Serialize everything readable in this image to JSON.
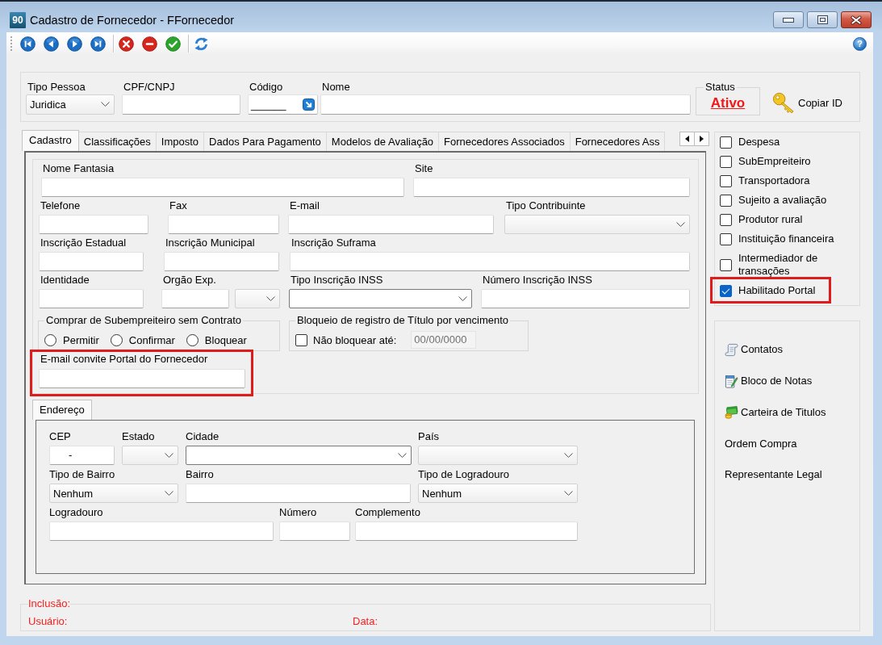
{
  "window": {
    "title": "Cadastro de Fornecedor - FFornecedor",
    "logo": "90",
    "help": "?"
  },
  "header": {
    "fields": [
      {
        "label": "Tipo Pessoa",
        "kind": "select",
        "value": "Juridica"
      },
      {
        "label": "CPF/CNPJ",
        "kind": "text"
      },
      {
        "label": "Código",
        "kind": "lookup",
        "value": "______"
      },
      {
        "label": "Nome",
        "kind": "text"
      }
    ],
    "status": {
      "label": "Status",
      "value": "Ativo"
    },
    "copy_id": "Copiar ID"
  },
  "tabs": [
    {
      "label": "Cadastro",
      "selected": true
    },
    {
      "label": "Classificações",
      "selected": false
    },
    {
      "label": "Imposto",
      "selected": false
    },
    {
      "label": "Dados Para Pagamento",
      "selected": false
    },
    {
      "label": "Modelos de Avaliação",
      "selected": false
    },
    {
      "label": "Fornecedores Associados",
      "selected": false
    },
    {
      "label": "Fornecedores Ass",
      "selected": false
    }
  ],
  "cadastro": {
    "lines": [
      {
        "fields": [
          {
            "label": "Nome Fantasia",
            "kind": "text"
          },
          {
            "label": "Site",
            "kind": "text"
          }
        ]
      },
      {
        "fields": [
          {
            "label": "Telefone",
            "kind": "text"
          },
          {
            "label": "Fax",
            "kind": "text"
          },
          {
            "label": "E-mail",
            "kind": "text"
          },
          {
            "label": "Tipo Contribuinte",
            "kind": "select"
          }
        ]
      },
      {
        "fields": [
          {
            "label": "Inscrição Estadual",
            "kind": "text"
          },
          {
            "label": "Inscrição Municipal",
            "kind": "text"
          },
          {
            "label": "Inscrição Suframa",
            "kind": "text"
          }
        ]
      },
      {
        "fields": [
          {
            "label": "Identidade",
            "kind": "text"
          },
          {
            "label": "Orgão Exp.",
            "kind": "text"
          },
          {
            "kind": "select"
          },
          {
            "label": "Tipo Inscrição INSS",
            "kind": "combo"
          },
          {
            "label": "Número Inscrição INSS",
            "kind": "text"
          }
        ]
      }
    ],
    "purchase_group": {
      "title": "Comprar de Subempreiteiro sem Contrato",
      "options": [
        {
          "label": "Permitir",
          "selected": false
        },
        {
          "label": "Confirmar",
          "selected": false
        },
        {
          "label": "Bloquear",
          "selected": false
        }
      ]
    },
    "block_group": {
      "title": "Bloqueio de registro de Título por vencimento",
      "checkbox": {
        "label": "Não bloquear até:",
        "checked": false
      },
      "date": {
        "value": "00/00/0000",
        "disabled": true
      }
    },
    "invite_email": {
      "label": "E-mail convite Portal do Fornecedor",
      "kind": "text",
      "highlighted": true
    }
  },
  "address": {
    "tabs": [
      {
        "label": "Endereço",
        "selected": true
      }
    ],
    "lines": [
      {
        "fields": [
          {
            "label": "CEP",
            "kind": "masked",
            "value": "-"
          },
          {
            "label": "Estado",
            "kind": "select"
          },
          {
            "label": "Cidade",
            "kind": "combo"
          },
          {
            "label": "País",
            "kind": "select"
          }
        ]
      },
      {
        "fields": [
          {
            "label": "Tipo de Bairro",
            "kind": "select",
            "value": "Nenhum"
          },
          {
            "label": "Bairro",
            "kind": "text"
          },
          {
            "label": "Tipo de Logradouro",
            "kind": "select",
            "value": "Nenhum"
          }
        ]
      },
      {
        "fields": [
          {
            "label": "Logradouro",
            "kind": "text"
          },
          {
            "label": "Número",
            "kind": "text"
          },
          {
            "label": "Complemento",
            "kind": "text"
          }
        ]
      }
    ]
  },
  "footer": {
    "inclusion": "Inclusão:",
    "user": "Usuário:",
    "date": "Data:"
  },
  "flags": [
    {
      "label": "Despesa",
      "checked": false,
      "highlighted": false
    },
    {
      "label": "SubEmpreiteiro",
      "checked": false,
      "highlighted": false
    },
    {
      "label": "Transportadora",
      "checked": false,
      "highlighted": false
    },
    {
      "label": "Sujeito a avaliação",
      "checked": false,
      "highlighted": false
    },
    {
      "label": "Produtor rural",
      "checked": false,
      "highlighted": false
    },
    {
      "label": "Instituição financeira",
      "checked": false,
      "highlighted": false
    },
    {
      "label": "Intermediador de transações",
      "checked": false,
      "highlighted": false
    },
    {
      "label": "Habilitado Portal",
      "checked": true,
      "highlighted": true
    }
  ],
  "actions": [
    {
      "label": "Contatos",
      "kind": "contacts"
    },
    {
      "label": "Bloco de Notas",
      "kind": "notes"
    },
    {
      "label": "Carteira de Titulos",
      "kind": "titles"
    },
    {
      "label": "Ordem Compra",
      "kind": "text"
    },
    {
      "label": "Representante Legal",
      "kind": "text"
    }
  ]
}
